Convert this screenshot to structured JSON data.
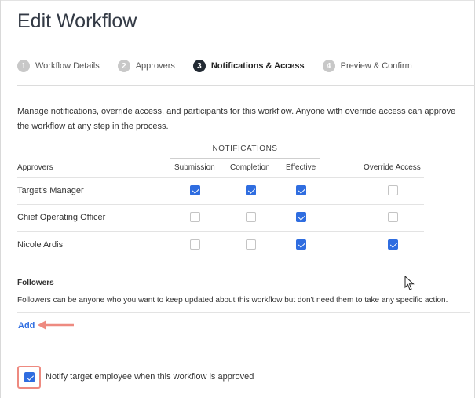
{
  "page": {
    "title": "Edit Workflow"
  },
  "stepper": {
    "steps": [
      {
        "number": "1",
        "label": "Workflow Details",
        "active": false
      },
      {
        "number": "2",
        "label": "Approvers",
        "active": false
      },
      {
        "number": "3",
        "label": "Notifications & Access",
        "active": true
      },
      {
        "number": "4",
        "label": "Preview & Confirm",
        "active": false
      }
    ]
  },
  "description": "Manage notifications, override access, and participants for this workflow. Anyone with override access can approve the workflow at any step in the process.",
  "table": {
    "group_header": "NOTIFICATIONS",
    "columns": {
      "approvers": "Approvers",
      "submission": "Submission",
      "completion": "Completion",
      "effective": "Effective",
      "override": "Override Access"
    },
    "rows": [
      {
        "name": "Target's Manager",
        "submission": true,
        "completion": true,
        "effective": true,
        "override": false
      },
      {
        "name": "Chief Operating Officer",
        "submission": false,
        "completion": false,
        "effective": true,
        "override": false
      },
      {
        "name": "Nicole Ardis",
        "submission": false,
        "completion": false,
        "effective": true,
        "override": true
      }
    ]
  },
  "followers": {
    "title": "Followers",
    "description": "Followers can be anyone who you want to keep updated about this workflow but don't need them to take any specific action.",
    "add_label": "Add"
  },
  "notify": {
    "label": "Notify target employee when this workflow is approved",
    "checked": true
  },
  "colors": {
    "accent": "#2f6de0",
    "highlight": "#ee8a80",
    "active_step": "#222a33"
  }
}
